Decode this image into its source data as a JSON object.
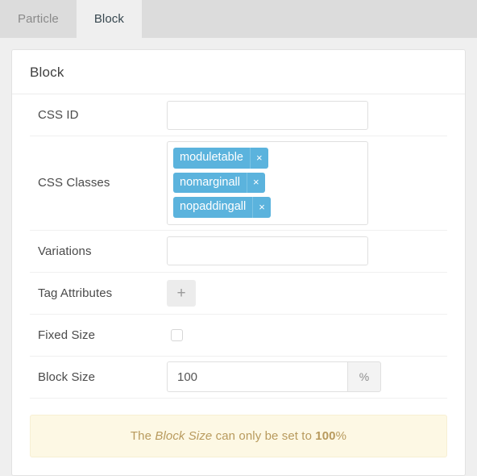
{
  "tabs": [
    {
      "label": "Particle",
      "active": false
    },
    {
      "label": "Block",
      "active": true
    }
  ],
  "panel": {
    "title": "Block",
    "rows": {
      "css_id": {
        "label": "CSS ID",
        "value": "",
        "placeholder": ""
      },
      "css_classes": {
        "label": "CSS Classes",
        "tags": [
          {
            "name": "moduletable",
            "remove": "×"
          },
          {
            "name": "nomarginall",
            "remove": "×"
          },
          {
            "name": "nopaddingall",
            "remove": "×"
          }
        ]
      },
      "variations": {
        "label": "Variations",
        "value": "",
        "placeholder": ""
      },
      "tag_attributes": {
        "label": "Tag Attributes",
        "add_label": "+"
      },
      "fixed_size": {
        "label": "Fixed Size",
        "checked": false
      },
      "block_size": {
        "label": "Block Size",
        "value": "100",
        "unit": "%"
      }
    },
    "notice": {
      "text_before": "The ",
      "emphasis": "Block Size",
      "text_middle": " can only be set to ",
      "strong": "100",
      "text_after": "%"
    }
  },
  "colors": {
    "tag_blue": "#5bb3dd",
    "notice_bg": "#fdf8e4",
    "notice_text": "#b89a5d",
    "tabbar_bg": "#dcdcdc",
    "page_bg": "#efefef"
  }
}
